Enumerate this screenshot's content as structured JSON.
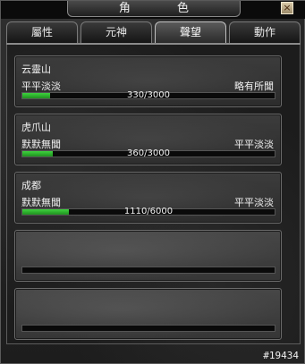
{
  "window": {
    "title": "角 色",
    "close_label": "×"
  },
  "tabs": [
    {
      "label": "屬性"
    },
    {
      "label": "元神"
    },
    {
      "label": "聲望",
      "active": true
    },
    {
      "label": "動作"
    }
  ],
  "reputation": [
    {
      "name": "云靈山",
      "rank_left": "平平淡淡",
      "rank_right": "略有所聞",
      "value_text": "330/3000",
      "progress": 0.11
    },
    {
      "name": "虎爪山",
      "rank_left": "默默無聞",
      "rank_right": "平平淡淡",
      "value_text": "360/3000",
      "progress": 0.12
    },
    {
      "name": "成都",
      "rank_left": "默默無聞",
      "rank_right": "平平淡淡",
      "value_text": "1110/6000",
      "progress": 0.185
    },
    {
      "name": "",
      "rank_left": "",
      "rank_right": "",
      "value_text": "",
      "progress": 0
    },
    {
      "name": "",
      "rank_left": "",
      "rank_right": "",
      "value_text": "",
      "progress": 0
    }
  ],
  "footer": {
    "id": "#19434"
  },
  "colors": {
    "bar": "#2fbf2f"
  }
}
